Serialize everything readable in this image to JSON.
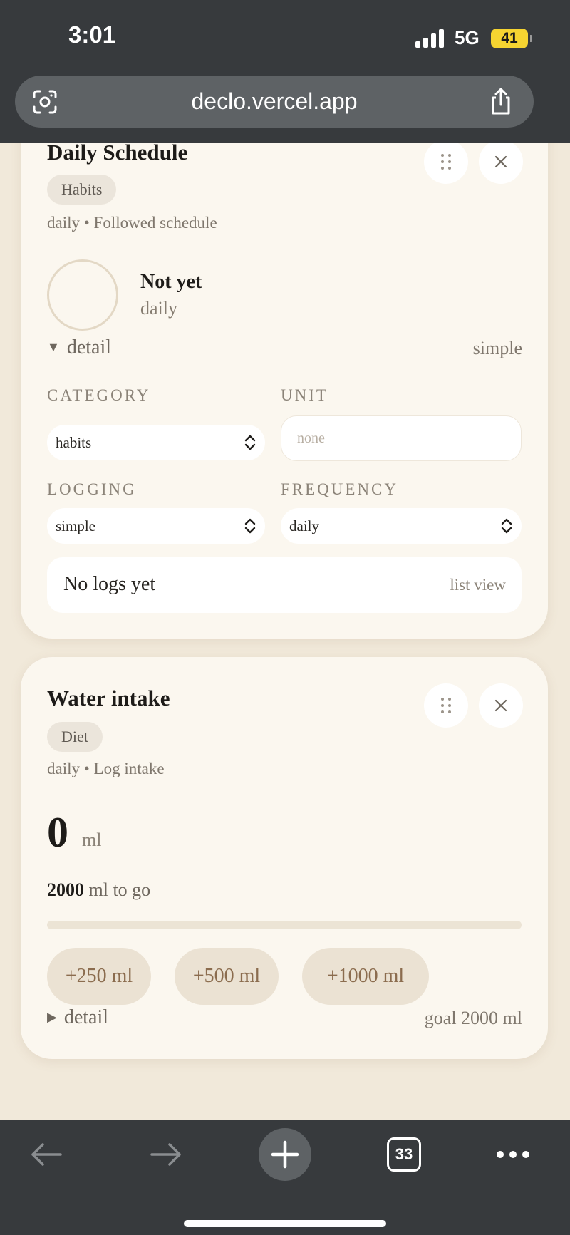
{
  "status_bar": {
    "time": "3:01",
    "network": "5G",
    "battery": "41"
  },
  "browser": {
    "url": "declo.vercel.app",
    "tabs_count": "33"
  },
  "cards": [
    {
      "title": "Daily Schedule",
      "tag": "Habits",
      "meta": "daily • Followed schedule",
      "status_title": "Not yet",
      "status_sub": "daily",
      "detail_toggle": "detail",
      "mode_note": "simple",
      "fields": {
        "category_label": "CATEGORY",
        "category_value": "habits",
        "unit_label": "UNIT",
        "unit_placeholder": "none",
        "logging_label": "LOGGING",
        "logging_value": "simple",
        "frequency_label": "FREQUENCY",
        "frequency_value": "daily"
      },
      "logs_empty": "No logs yet",
      "list_view": "list view"
    },
    {
      "title": "Water intake",
      "tag": "Diet",
      "meta": "daily • Log intake",
      "amount": "0",
      "amount_unit": "ml",
      "remaining_value": "2000",
      "remaining_text": "ml to go",
      "progress_fraction": 0,
      "quick_add": [
        "+250 ml",
        "+500 ml",
        "+1000 ml"
      ],
      "detail_toggle": "detail",
      "goal_text": "goal 2000 ml"
    }
  ],
  "colors": {
    "page_bg": "#f1e9da",
    "card_bg": "#fbf7ef",
    "chrome_bg": "#373a3d",
    "accent_button": "#ebe2d3",
    "battery": "#f5d431"
  }
}
